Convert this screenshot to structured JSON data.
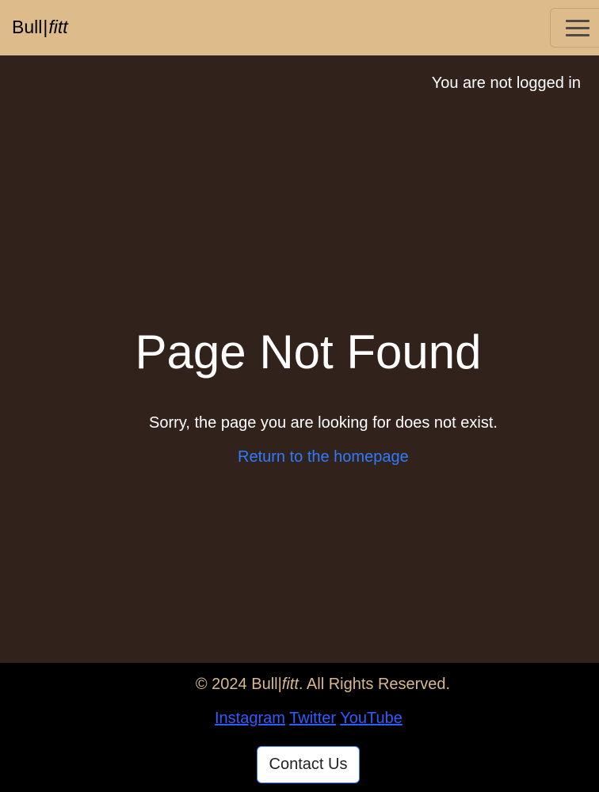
{
  "navbar": {
    "brand_main": "Bull",
    "brand_separator": "|",
    "brand_suffix": "fitt",
    "menu_icon": "hamburger-icon"
  },
  "main": {
    "login_status": "You are not logged in",
    "title": "Page Not Found",
    "message": "Sorry, the page you are looking for does not exist.",
    "home_link": "Return to the homepage"
  },
  "footer": {
    "copyright_prefix": "© 2024 Bull|",
    "copyright_brand": "fitt",
    "copyright_suffix": ". All Rights Reserved.",
    "social_links": [
      "Instagram",
      "Twitter",
      "YouTube"
    ],
    "contact_button": "Contact Us"
  },
  "colors": {
    "navbar_bg": "#debb8b",
    "main_bg": "#31221c",
    "footer_bg": "#000000",
    "link": "#2f7bff",
    "footer_text": "#d9b88e"
  }
}
